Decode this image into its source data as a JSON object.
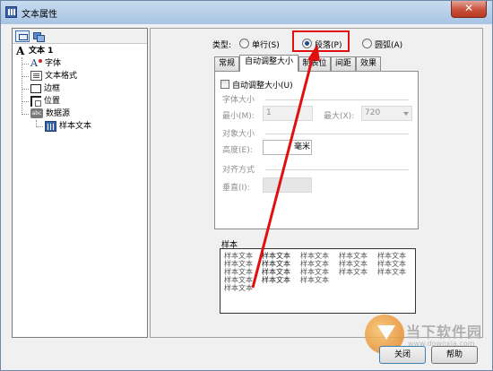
{
  "window": {
    "title": "文本属性",
    "close_glyph": "✕"
  },
  "tree": {
    "root": "文本 1",
    "items": [
      "字体",
      "文本格式",
      "边框",
      "位置",
      "数据源"
    ],
    "child": "样本文本",
    "db_icon_text": "abc"
  },
  "type_selector": {
    "label": "类型:",
    "options": [
      "单行(S)",
      "段落(P)",
      "圆弧(A)"
    ],
    "selected": "段落(P)"
  },
  "tabs": [
    "常规",
    "自动调整大小",
    "制表位",
    "间距",
    "效果"
  ],
  "active_tab": "自动调整大小",
  "autosize": {
    "checkbox_label": "自动调整大小(U)",
    "font_size_group": "字体大小",
    "min_label": "最小(M):",
    "min_value": "1",
    "max_label": "最大(X):",
    "max_value": "720",
    "object_size_group": "对象大小",
    "height_label": "高度(E):",
    "height_unit": "毫米",
    "align_group": "对齐方式",
    "vertical_label": "垂直(I):"
  },
  "sample": {
    "label": "样本",
    "text": "样本文本",
    "columns": [
      [
        "样本文本",
        "样本文本",
        "样本文本",
        "样本文本",
        "样本文本"
      ],
      [
        "样本文本",
        "样本文本",
        "样本文本",
        "样本文本"
      ],
      [
        "样本文本",
        "样本文本",
        "样本文本",
        "样本文本"
      ],
      [
        "样本文本",
        "样本文本",
        "样本文本"
      ],
      [
        "样本文本",
        "样本文本",
        "样本文本"
      ]
    ]
  },
  "buttons": {
    "close": "关闭",
    "help": "帮助"
  },
  "watermark": {
    "text": "当下软件园",
    "url": "www.downxia.com"
  },
  "colors": {
    "annotation": "#e01010",
    "titlebar": "#a7c4e3",
    "close_button": "#c8503a"
  }
}
